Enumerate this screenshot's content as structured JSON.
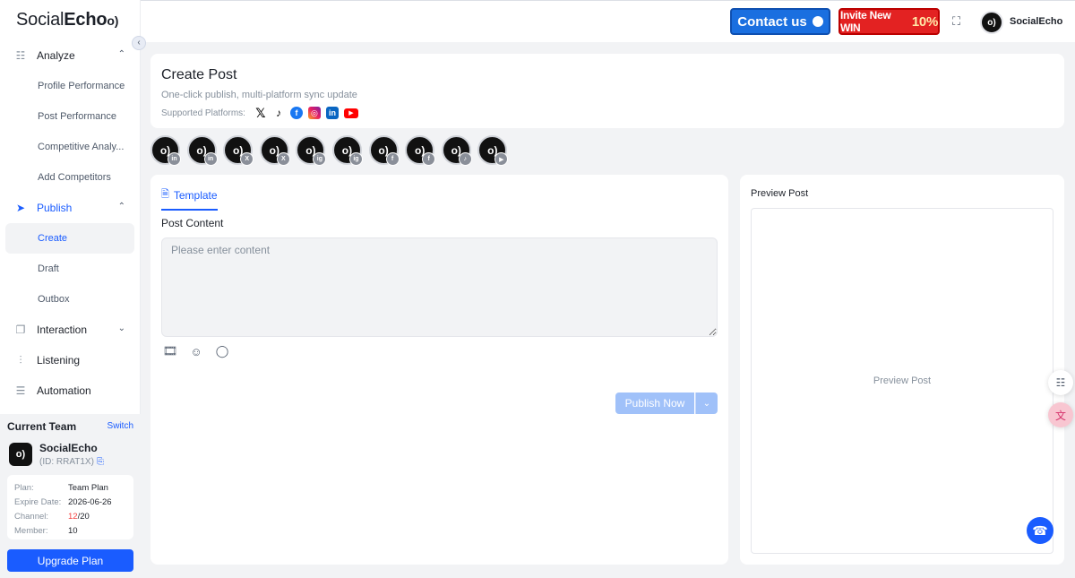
{
  "app": {
    "logo_light": "Social",
    "logo_bold": "Echo",
    "logo_mark": "o)"
  },
  "sidebar": {
    "analyze": {
      "label": "Analyze",
      "items": [
        "Profile Performance",
        "Post Performance",
        "Competitive Analy...",
        "Add Competitors"
      ]
    },
    "publish": {
      "label": "Publish",
      "items": [
        "Create",
        "Draft",
        "Outbox"
      ]
    },
    "interaction": "Interaction",
    "listening": "Listening",
    "automation": "Automation"
  },
  "team": {
    "title": "Current Team",
    "switch": "Switch",
    "name": "SocialEcho",
    "id": "(ID: RRAT1X)",
    "avatar": "o)",
    "plan_label": "Plan:",
    "plan_value": "Team Plan",
    "expire_label": "Expire Date:",
    "expire_value": "2026-06-26",
    "channel_label": "Channel:",
    "channel_used": "12",
    "channel_total": "/20",
    "member_label": "Member:",
    "member_value": "10",
    "upgrade": "Upgrade Plan"
  },
  "header": {
    "contact": "Contact us",
    "invite_text": "Invite New WIN",
    "invite_percent": "10%",
    "user_name": "SocialEcho",
    "user_avatar": "o)"
  },
  "page": {
    "title": "Create Post",
    "subtitle": "One-click publish, multi-platform sync update",
    "platforms_label": "Supported Platforms:",
    "platforms": [
      "X",
      "TikTok",
      "Facebook",
      "Instagram",
      "LinkedIn",
      "YouTube"
    ]
  },
  "accounts": [
    {
      "avatar": "o)",
      "badge": "in"
    },
    {
      "avatar": "o)",
      "badge": "in"
    },
    {
      "avatar": "o)",
      "badge": "X"
    },
    {
      "avatar": "o)",
      "badge": "X"
    },
    {
      "avatar": "o)",
      "badge": "ig"
    },
    {
      "avatar": "o)",
      "badge": "ig"
    },
    {
      "avatar": "o)",
      "badge": "f"
    },
    {
      "avatar": "o)",
      "badge": "f"
    },
    {
      "avatar": "o)",
      "badge": "♪"
    },
    {
      "avatar": "o)",
      "badge": "▶"
    }
  ],
  "editor": {
    "tab": "Template",
    "content_label": "Post Content",
    "content_placeholder": "Please enter content",
    "content_value": "",
    "publish": "Publish Now"
  },
  "preview": {
    "title": "Preview Post",
    "placeholder": "Preview Post"
  },
  "colors": {
    "accent": "#1a5cff",
    "contact_bg": "#1a6fe0",
    "invite_bg": "#e32222",
    "publish_disabled": "#a0c1f9"
  }
}
